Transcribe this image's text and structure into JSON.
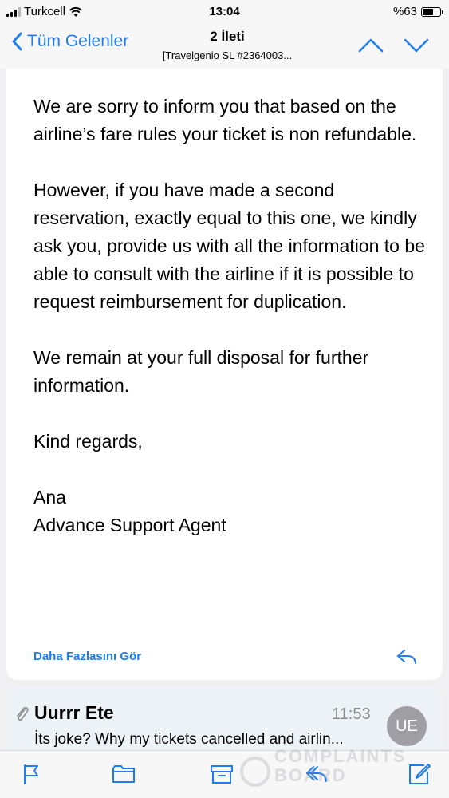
{
  "status_bar": {
    "carrier": "Turkcell",
    "time": "13:04",
    "battery_percent": "%63",
    "battery_level": 0.63
  },
  "nav": {
    "back_label": "Tüm Gelenler",
    "title": "2 İleti",
    "subtitle": "[Travelgenio SL #2364003..."
  },
  "message": {
    "paragraphs": [
      "We are sorry to inform you that based on the airline’s fare rules your ticket is non refundable.",
      "However, if you have made a second reservation, exactly equal to this one, we kindly ask you, provide us with all the information to be able to consult with the airline if it is possible to request reimbursement for duplication.",
      "We remain at your full disposal for further information.",
      "Kind regards,"
    ],
    "signature_name": "Ana",
    "signature_title": "Advance Support Agent",
    "see_more": "Daha Fazlasını Gör"
  },
  "next_message": {
    "sender": "Uurrr Ete",
    "time": "11:53",
    "preview": "İts joke? Why my tickets cancelled and airlin...",
    "avatar_initials": "UE"
  },
  "toolbar": {
    "items": [
      "flag-icon",
      "folder-icon",
      "archive-icon",
      "reply-all-icon",
      "compose-icon"
    ]
  },
  "watermark": {
    "line1": "COMPLAINTS",
    "line2": "BOARD"
  },
  "colors": {
    "accent": "#1f7cf5",
    "background": "#f0f0f2",
    "card": "#ffffff",
    "next_card": "#edf2f7"
  }
}
